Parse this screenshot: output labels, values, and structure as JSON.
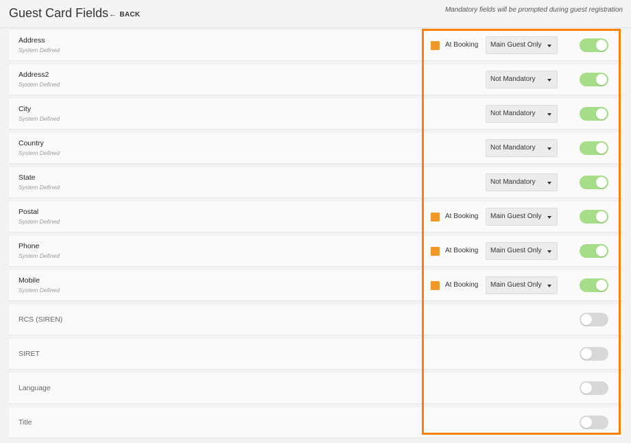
{
  "header": {
    "title": "Guest Card Fields",
    "back_label": "BACK",
    "note": "Mandatory fields will be prompted during guest registration"
  },
  "colors": {
    "accent_orange": "#f0992a",
    "toggle_on": "#a6dd88",
    "toggle_off": "#d8d8d8",
    "highlight_border": "#ff7f00"
  },
  "rows": [
    {
      "name": "Address",
      "sub": "System Defined",
      "at_booking": "At Booking",
      "select": "Main Guest Only",
      "enabled": true
    },
    {
      "name": "Address2",
      "sub": "System Defined",
      "at_booking": "",
      "select": "Not Mandatory",
      "enabled": true
    },
    {
      "name": "City",
      "sub": "System Defined",
      "at_booking": "",
      "select": "Not Mandatory",
      "enabled": true
    },
    {
      "name": "Country",
      "sub": "System Defined",
      "at_booking": "",
      "select": "Not Mandatory",
      "enabled": true
    },
    {
      "name": "State",
      "sub": "System Defined",
      "at_booking": "",
      "select": "Not Mandatory",
      "enabled": true
    },
    {
      "name": "Postal",
      "sub": "System Defined",
      "at_booking": "At Booking",
      "select": "Main Guest Only",
      "enabled": true
    },
    {
      "name": "Phone",
      "sub": "System Defined",
      "at_booking": "At Booking",
      "select": "Main Guest Only",
      "enabled": true
    },
    {
      "name": "Mobile",
      "sub": "System Defined",
      "at_booking": "At Booking",
      "select": "Main Guest Only",
      "enabled": true
    },
    {
      "name": "RCS (SIREN)",
      "sub": "",
      "at_booking": "",
      "select": "",
      "enabled": false
    },
    {
      "name": "SIRET",
      "sub": "",
      "at_booking": "",
      "select": "",
      "enabled": false
    },
    {
      "name": "Language",
      "sub": "",
      "at_booking": "",
      "select": "",
      "enabled": false
    },
    {
      "name": "Title",
      "sub": "",
      "at_booking": "",
      "select": "",
      "enabled": false
    }
  ]
}
